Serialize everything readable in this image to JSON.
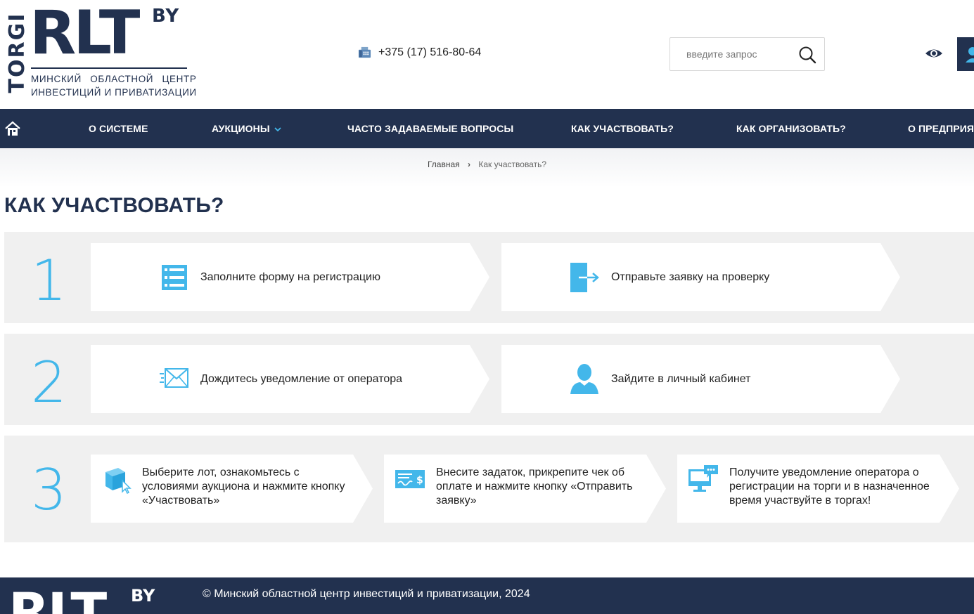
{
  "header": {
    "logo": {
      "torgi": "TORGI",
      "rlt": "RLT",
      "by": "BY",
      "sub1": "МИНСКИЙ ОБЛАСТНОЙ ЦЕНТР",
      "sub2": "ИНВЕСТИЦИЙ И ПРИВАТИЗАЦИИ"
    },
    "phone": "+375 (17) 516-80-64",
    "search": {
      "placeholder": "введите запрос",
      "value": ""
    }
  },
  "nav": {
    "items": [
      {
        "label": "О СИСТЕМЕ"
      },
      {
        "label": "АУКЦИОНЫ",
        "has_dropdown": true
      },
      {
        "label": "ЧАСТО ЗАДАВАЕМЫЕ ВОПРОСЫ"
      },
      {
        "label": "КАК УЧАСТВОВАТЬ?"
      },
      {
        "label": "КАК ОРГАНИЗОВАТЬ?"
      },
      {
        "label": "О ПРЕДПРИЯТ"
      }
    ]
  },
  "breadcrumb": {
    "home": "Главная",
    "current": "Как участвовать?"
  },
  "page_title": "КАК УЧАСТВОВАТЬ?",
  "steps": [
    {
      "number": "1",
      "cards": [
        {
          "icon": "form-icon",
          "text": "Заполните форму на регистрацию"
        },
        {
          "icon": "send-request-icon",
          "text": "Отправьте заявку на проверку"
        }
      ]
    },
    {
      "number": "2",
      "cards": [
        {
          "icon": "envelope-icon",
          "text": "Дождитесь уведомление от оператора"
        },
        {
          "icon": "user-icon",
          "text": "Зайдите в личный кабинет"
        }
      ]
    },
    {
      "number": "3",
      "cards": [
        {
          "icon": "cube-cursor-icon",
          "text": "Выберите лот, ознакомьтесь с условиями аукциона и нажмите кнопку «Участвовать»"
        },
        {
          "icon": "check-payment-icon",
          "text": "Внесите задаток, прикрепите чек об оплате и нажмите кнопку «Отправить заявку»"
        },
        {
          "icon": "monitor-chat-icon",
          "text": "Получите уведомление оператора о регистрации на торги и в назначенное время участвуйте в торгах!"
        }
      ]
    }
  ],
  "footer": {
    "logo_rlt": "RLT",
    "logo_by": "BY",
    "copyright": "© Минский областной центр инвестиций и приватизации, 2024"
  },
  "colors": {
    "navy": "#22314f",
    "accent": "#43b7ea",
    "row_bg": "#f0f0f0"
  }
}
